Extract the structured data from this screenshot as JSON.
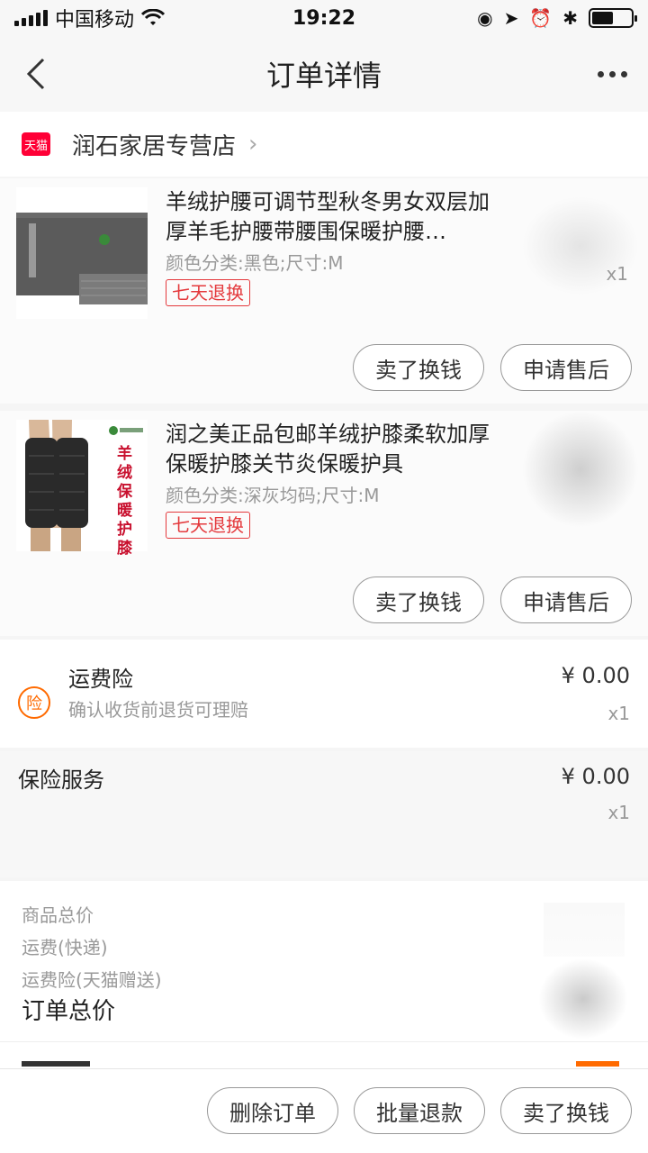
{
  "status_bar": {
    "carrier": "中国移动",
    "time": "19:22"
  },
  "nav": {
    "title": "订单详情"
  },
  "store": {
    "badge": "天猫",
    "name": "润石家居专营店"
  },
  "items": [
    {
      "title": "羊绒护腰可调节型秋冬男女双层加厚羊毛护腰带腰围保暖护腰…",
      "spec": "颜色分类:黑色;尺寸:M",
      "tag": "七天退换",
      "qty": "x1",
      "buttons": [
        "卖了换钱",
        "申请售后"
      ]
    },
    {
      "title": "润之美正品包邮羊绒护膝柔软加厚保暖护膝关节炎保暖护具",
      "spec": "颜色分类:深灰均码;尺寸:M",
      "tag": "七天退换",
      "qty": "",
      "buttons": [
        "卖了换钱",
        "申请售后"
      ],
      "image_text": "羊绒保暖护膝"
    }
  ],
  "freight_insurance": {
    "icon_text": "险",
    "title": "运费险",
    "desc": "确认收货前退货可理赔",
    "price": "¥ 0.00",
    "qty": "x1"
  },
  "insurance_service": {
    "title": "保险服务",
    "price": "¥ 0.00",
    "qty": "x1"
  },
  "totals": {
    "goods_label": "商品总价",
    "shipping_label": "运费(快递)",
    "freight_ins_label": "运费险(天猫赠送)",
    "order_total_label": "订单总价"
  },
  "bottom_buttons": {
    "delete": "删除订单",
    "batch_refund": "批量退款",
    "resell": "卖了换钱"
  },
  "colors": {
    "tmall_red": "#ff0036",
    "tag_red": "#e4393c",
    "insurance_orange": "#ff6a00"
  }
}
